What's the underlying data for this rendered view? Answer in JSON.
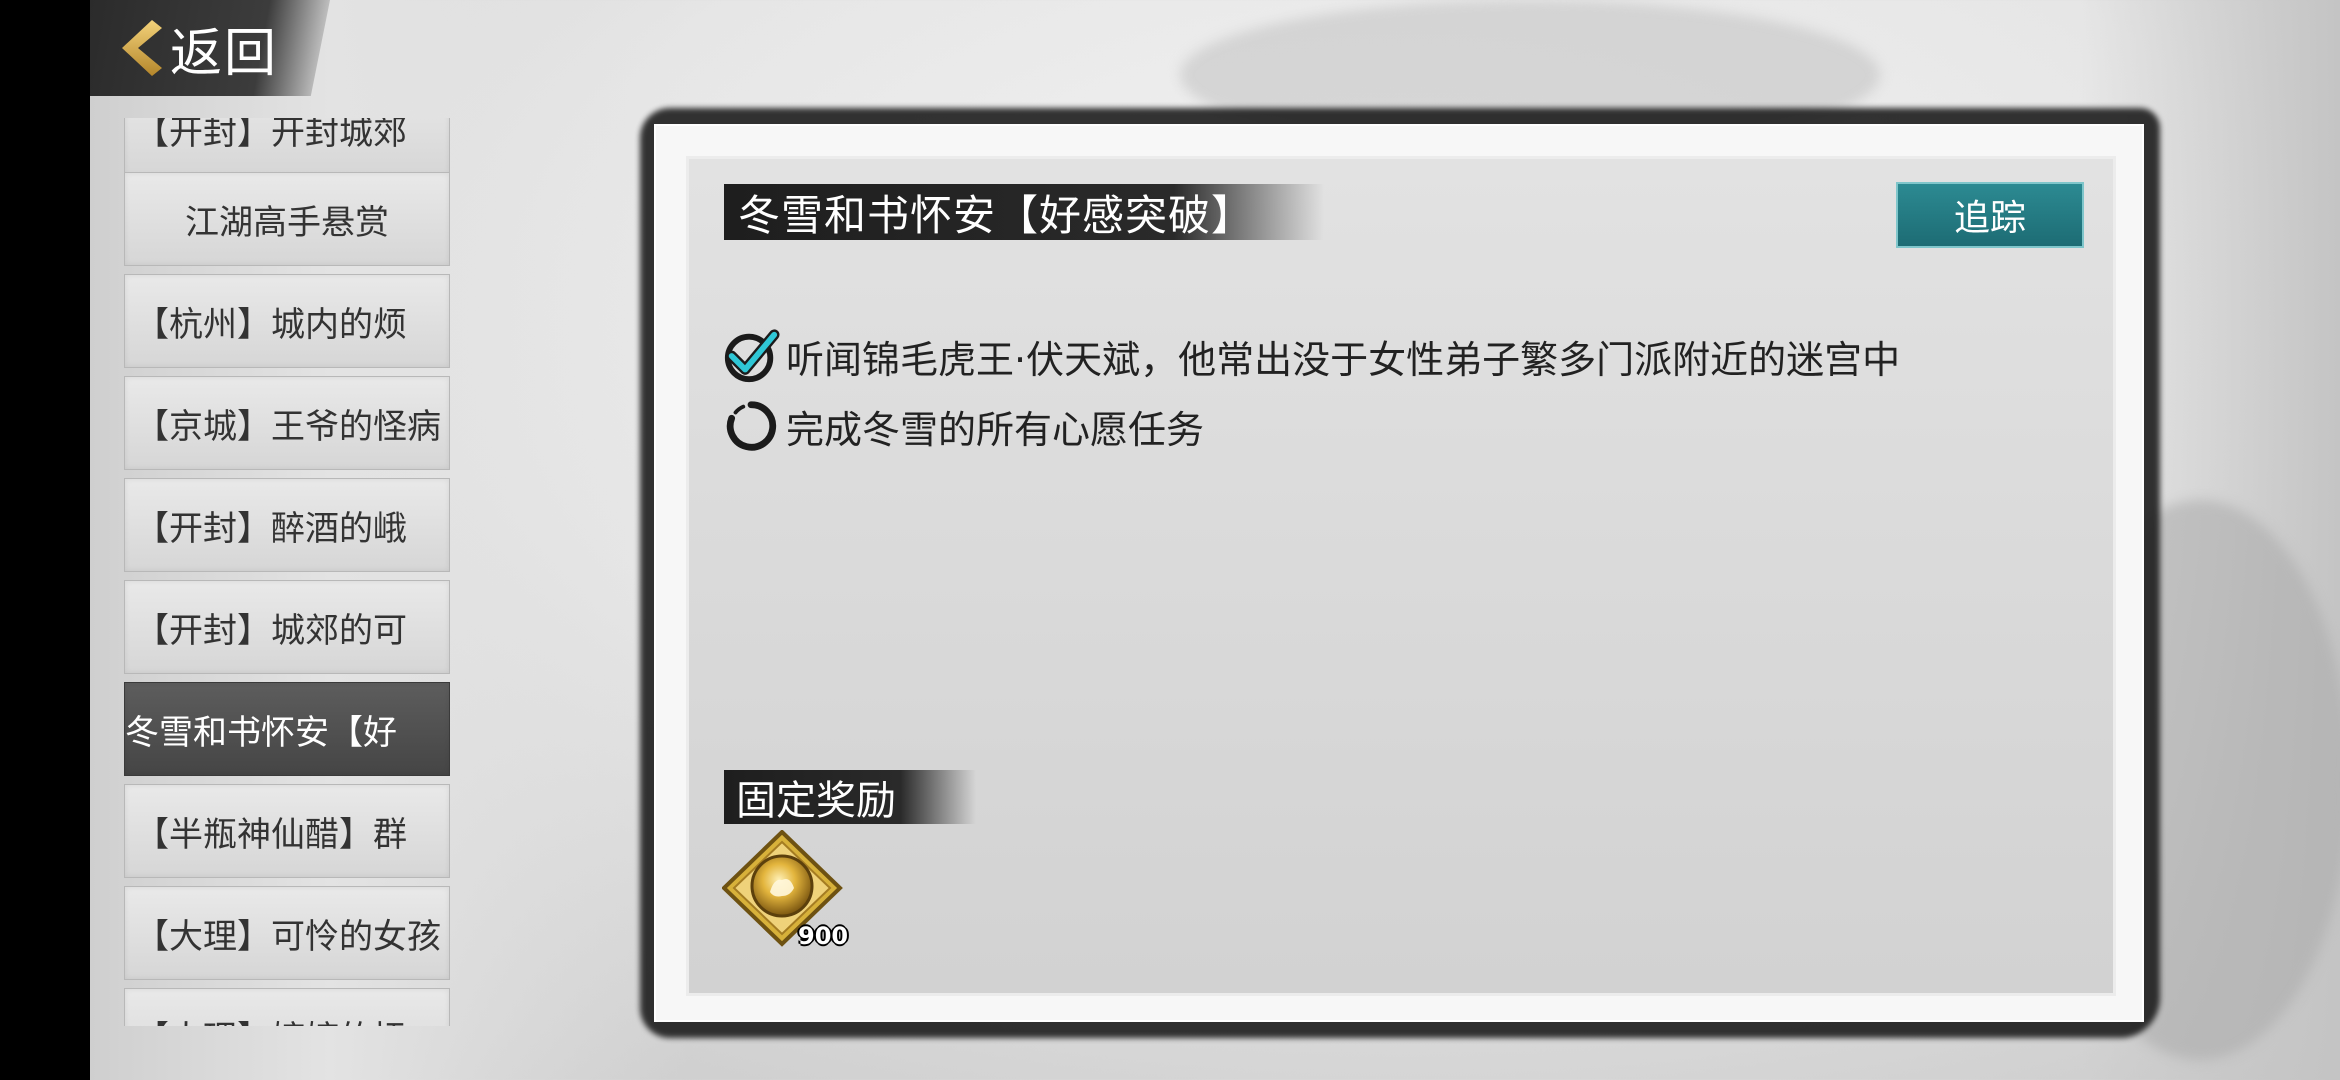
{
  "header": {
    "back_label": "返回"
  },
  "quest_list": {
    "items": [
      {
        "label": "【开封】开封城郊"
      },
      {
        "label": "江湖高手悬赏"
      },
      {
        "label": "【杭州】城内的烦"
      },
      {
        "label": "【京城】王爷的怪病"
      },
      {
        "label": "【开封】醉酒的峨"
      },
      {
        "label": "【开封】城郊的可"
      },
      {
        "label": "冬雪和书怀安【好"
      },
      {
        "label": "【半瓶神仙醋】群"
      },
      {
        "label": "【大理】可怜的女孩"
      },
      {
        "label": "【大理】婷婷的抚"
      }
    ],
    "active_index": 6
  },
  "quest_detail": {
    "title": "冬雪和书怀安【好感突破】",
    "track_label": "追踪",
    "objectives": [
      {
        "text": "听闻锦毛虎王·伏天斌，他常出没于女性弟子繁多门派附近的迷宫中",
        "status": "completed",
        "icon": "check-icon"
      },
      {
        "text": "完成冬雪的所有心愿任务",
        "status": "in-progress",
        "icon": "progress-ring-icon"
      }
    ],
    "reward_section_title": "固定奖励",
    "rewards": [
      {
        "icon": "gold-token-icon",
        "count": "900"
      }
    ]
  },
  "colors": {
    "accent_teal": "#1d6c74",
    "check_cyan": "#2fc7d6",
    "reward_gold": "#d7b13a"
  }
}
